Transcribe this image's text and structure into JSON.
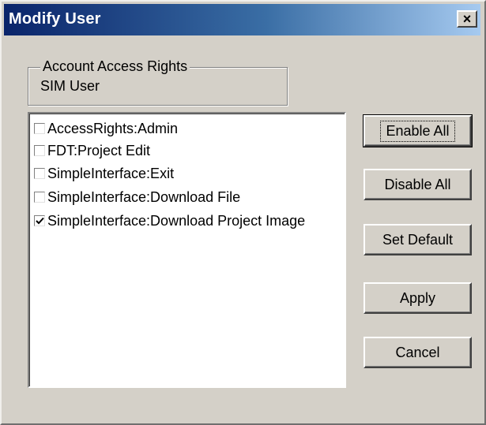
{
  "window": {
    "title": "Modify User",
    "close_label": "×"
  },
  "group": {
    "legend": "Account Access Rights",
    "value": "SIM User"
  },
  "rights": [
    {
      "label": "AccessRights:Admin",
      "checked": false
    },
    {
      "label": "FDT:Project Edit",
      "checked": false
    },
    {
      "label": "SimpleInterface:Exit",
      "checked": false
    },
    {
      "label": "SimpleInterface:Download File",
      "checked": false
    },
    {
      "label": "SimpleInterface:Download Project Image",
      "checked": true
    }
  ],
  "buttons": {
    "enable_all": "Enable All",
    "disable_all": "Disable All",
    "set_default": "Set Default",
    "apply": "Apply",
    "cancel": "Cancel"
  }
}
